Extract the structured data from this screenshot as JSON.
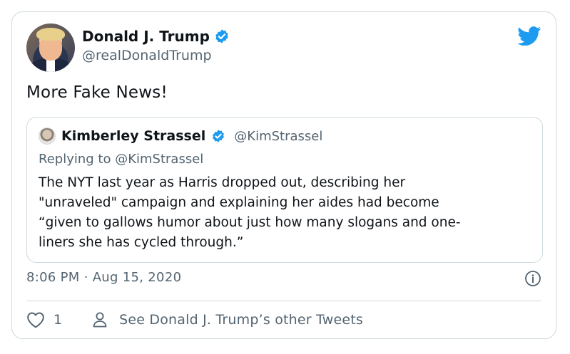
{
  "author": {
    "name": "Donald J. Trump",
    "handle": "@realDonaldTrump"
  },
  "tweet": {
    "text": "More Fake News!"
  },
  "quoted": {
    "name": "Kimberley Strassel",
    "handle": "@KimStrassel",
    "replying_to": "Replying to @KimStrassel",
    "body": "The NYT last year as Harris dropped out, describing her\n\"unraveled\" campaign and explaining her aides had become\n“given to gallows humor about just how many slogans and one-\nliners she has cycled through.”"
  },
  "meta": {
    "timestamp": "8:06 PM · Aug 15, 2020"
  },
  "actions": {
    "like_count": "1",
    "see_more": "See Donald J. Trump’s other Tweets"
  },
  "icons": {
    "verified": "verified-badge-icon",
    "bird": "twitter-bird-icon",
    "info": "info-icon",
    "heart": "heart-icon",
    "person": "person-icon"
  },
  "colors": {
    "accent": "#1d9bf0",
    "text": "#0f1419",
    "muted": "#536471",
    "border": "#cfd9de"
  }
}
